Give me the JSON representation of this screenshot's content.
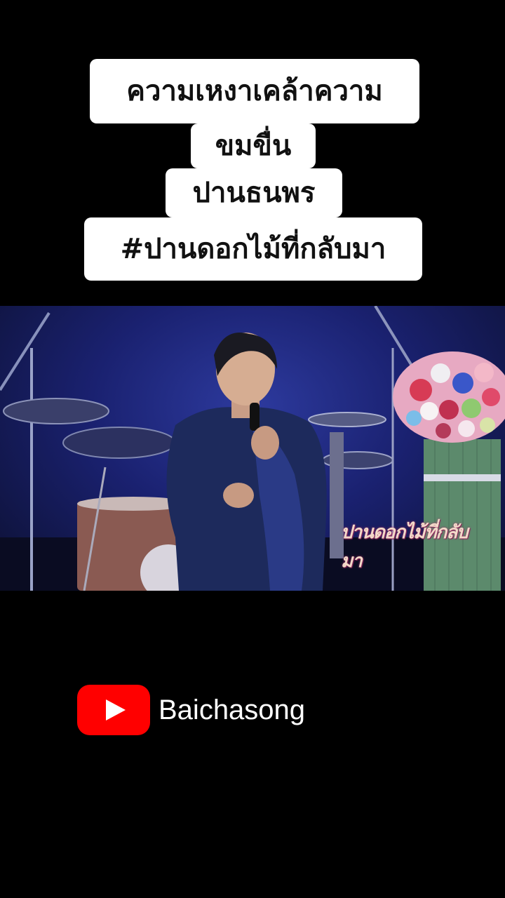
{
  "captions": [
    "ความเหงาเคล้าความ",
    "ขมขื่น",
    "ปานธนพร",
    "#ปานดอกไม้ที่กลับมา"
  ],
  "video": {
    "watermark_text": "ปานดอกไม้ที่กลับมา"
  },
  "channel": {
    "logo_icon": "youtube-icon",
    "logo_color": "#ff0000",
    "name": "Baichasong"
  }
}
